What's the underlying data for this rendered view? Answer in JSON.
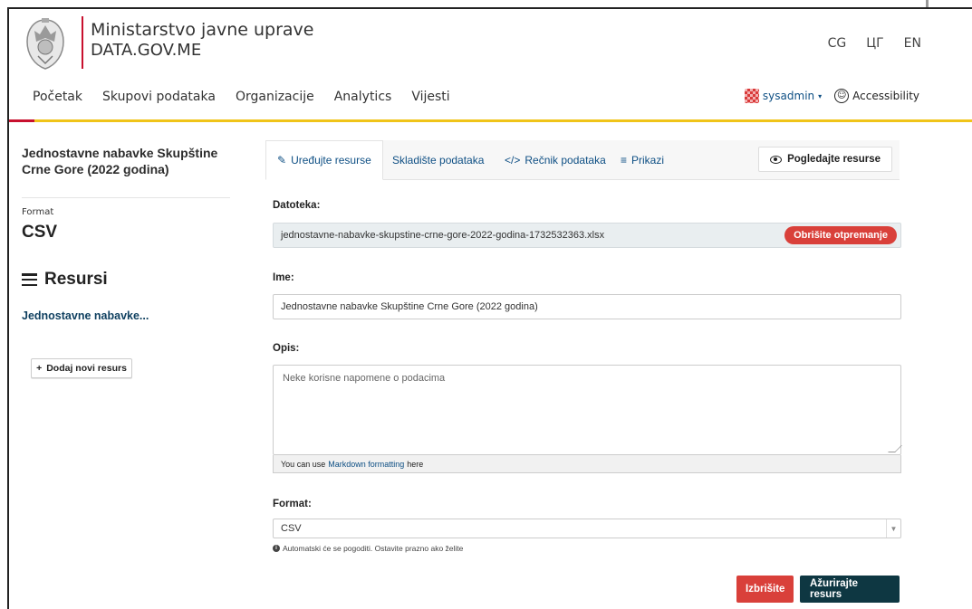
{
  "header": {
    "ministry": "Ministarstvo javne uprave",
    "site": "DATA.GOV.ME",
    "languages": [
      "CG",
      "ЦГ",
      "EN"
    ]
  },
  "nav": {
    "items": [
      "Početak",
      "Skupovi podataka",
      "Organizacije",
      "Analytics",
      "Vijesti"
    ],
    "user": "sysadmin",
    "accessibility": "Accessibility"
  },
  "sidebar": {
    "dataset_title": "Jednostavne nabavke Skupštine Crne Gore (2022 godina)",
    "format_label": "Format",
    "format_value": "CSV",
    "resources_heading": "Resursi",
    "resource_item": "Jednostavne nabavke...",
    "add_resource": "Dodaj novi resurs"
  },
  "tabs": {
    "edit": "Uređujte resurse",
    "datastore": "Skladište podataka",
    "dictionary": "Rečnik podataka",
    "views": "Prikazi",
    "view_resource": "Pogledajte resurse"
  },
  "form": {
    "file_label": "Datoteka:",
    "file_value": "jednostavne-nabavke-skupstine-crne-gore-2022-godina-1732532363.xlsx",
    "remove_upload": "Obrišite otpremanje",
    "name_label": "Ime:",
    "name_value": "Jednostavne nabavke Skupštine Crne Gore (2022 godina)",
    "description_label": "Opis:",
    "description_placeholder": "Neke korisne napomene o podacima",
    "markdown_prefix": "You can use",
    "markdown_link": "Markdown formatting",
    "markdown_suffix": "here",
    "format_label": "Format:",
    "format_value": "CSV",
    "format_help": "Automatski će se pogoditi. Ostavite prazno ako želite",
    "delete_button": "Izbrišite",
    "update_button": "Ažurirajte resurs"
  },
  "colors": {
    "accent_red": "#d9403a",
    "navbar_yellow": "#f0c419",
    "link_blue": "#0e4f84",
    "primary_dark": "#0e3742"
  }
}
